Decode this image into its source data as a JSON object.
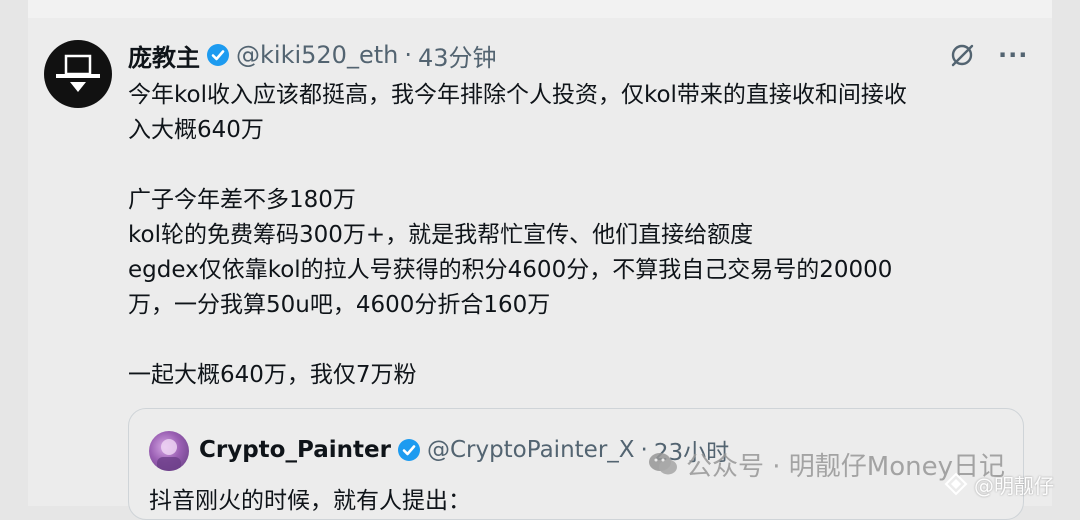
{
  "tweet": {
    "display_name": "庞教主",
    "handle": "@kiki520_eth",
    "separator": "·",
    "time": "43分钟",
    "more_label": "···",
    "lines": [
      "今年kol收入应该都挺高，我今年排除个人投资，仅kol带来的直接收和间接收",
      "入大概640万",
      "",
      "广子今年差不多180万",
      "kol轮的免费筹码300万+，就是我帮忙宣传、他们直接给额度",
      "egdex仅依靠kol的拉人号获得的积分4600分，不算我自己交易号的20000",
      "万，一分我算50u吧，4600分折合160万",
      "",
      "一起大概640万，我仅7万粉"
    ]
  },
  "quote": {
    "display_name": "Crypto_Painter",
    "handle": "@CryptoPainter_X",
    "separator": "·",
    "time": "23小时",
    "text": "抖音刚火的时候，就有人提出："
  },
  "watermark": {
    "text": "公众号 · 明靓仔Money日记",
    "tag": "@明靓仔"
  },
  "colors": {
    "verified": "#1d9bf0",
    "secondary_text": "#536471",
    "background": "#ececec"
  },
  "icons": {
    "verified": "verified-badge-icon",
    "grok": "grok-icon",
    "more": "more-icon",
    "wechat": "wechat-icon",
    "diamond": "diamond-icon"
  }
}
